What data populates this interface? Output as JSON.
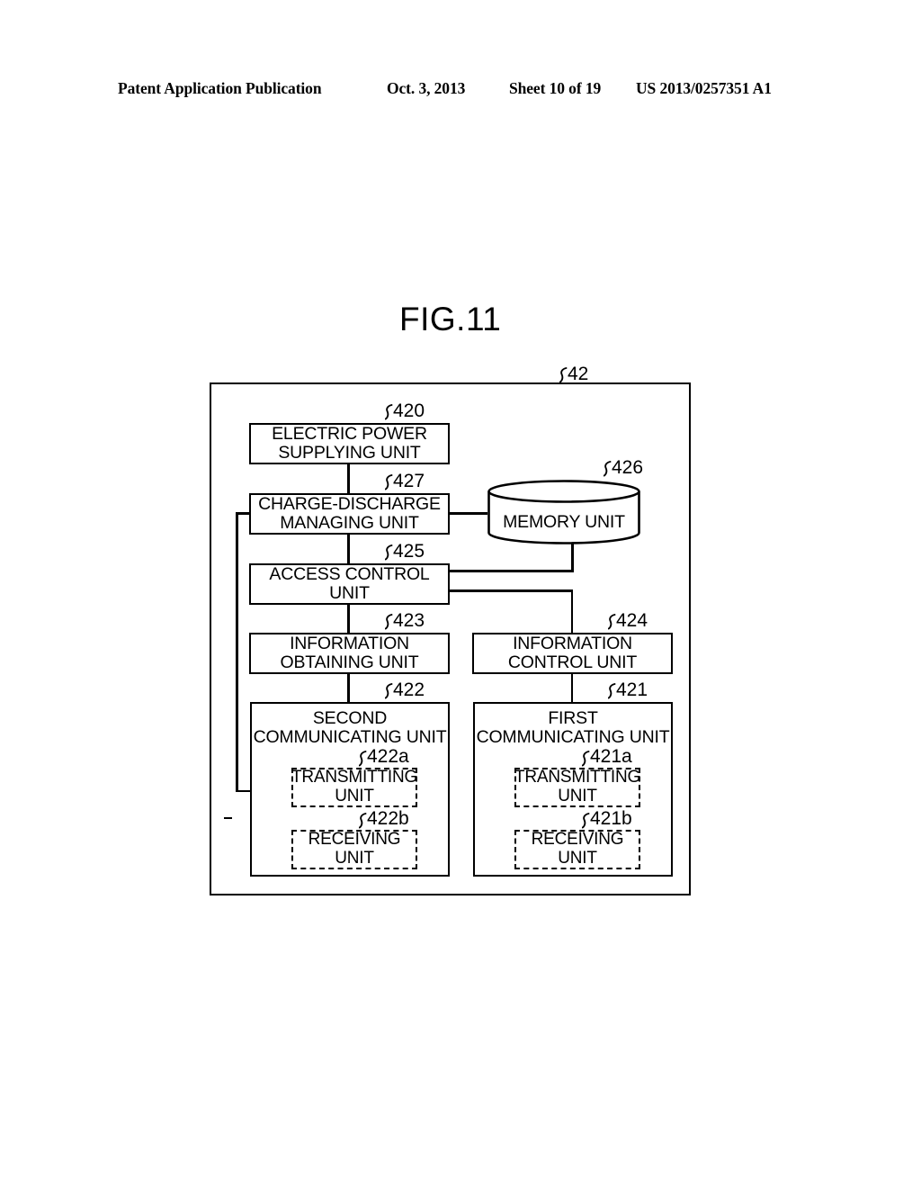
{
  "header": {
    "publication": "Patent Application Publication",
    "date": "Oct. 3, 2013",
    "sheet": "Sheet 10 of 19",
    "patent_number": "US 2013/0257351 A1"
  },
  "figure": {
    "title": "FIG.11",
    "outer_ref": "42"
  },
  "blocks": {
    "electric_power_supplying_unit": {
      "ref": "420",
      "line1": "ELECTRIC POWER",
      "line2": "SUPPLYING UNIT"
    },
    "charge_discharge_managing_unit": {
      "ref": "427",
      "line1": "CHARGE-DISCHARGE",
      "line2": "MANAGING UNIT"
    },
    "access_control_unit": {
      "ref": "425",
      "line1": "ACCESS CONTROL",
      "line2": "UNIT"
    },
    "memory_unit": {
      "ref": "426",
      "label": "MEMORY UNIT"
    },
    "information_obtaining_unit": {
      "ref": "423",
      "line1": "INFORMATION",
      "line2": "OBTAINING UNIT"
    },
    "information_control_unit": {
      "ref": "424",
      "line1": "INFORMATION",
      "line2": "CONTROL UNIT"
    },
    "second_communicating_unit": {
      "ref": "422",
      "line1": "SECOND",
      "line2": "COMMUNICATING UNIT",
      "transmitting": {
        "ref": "422a",
        "line1": "TRANSMITTING",
        "line2": "UNIT"
      },
      "receiving": {
        "ref": "422b",
        "line1": "RECEIVING",
        "line2": "UNIT"
      }
    },
    "first_communicating_unit": {
      "ref": "421",
      "line1": "FIRST",
      "line2": "COMMUNICATING UNIT",
      "transmitting": {
        "ref": "421a",
        "line1": "TRANSMITTING",
        "line2": "UNIT"
      },
      "receiving": {
        "ref": "421b",
        "line1": "RECEIVING",
        "line2": "UNIT"
      }
    }
  },
  "colors": {
    "ink": "#000000",
    "paper": "#ffffff"
  }
}
